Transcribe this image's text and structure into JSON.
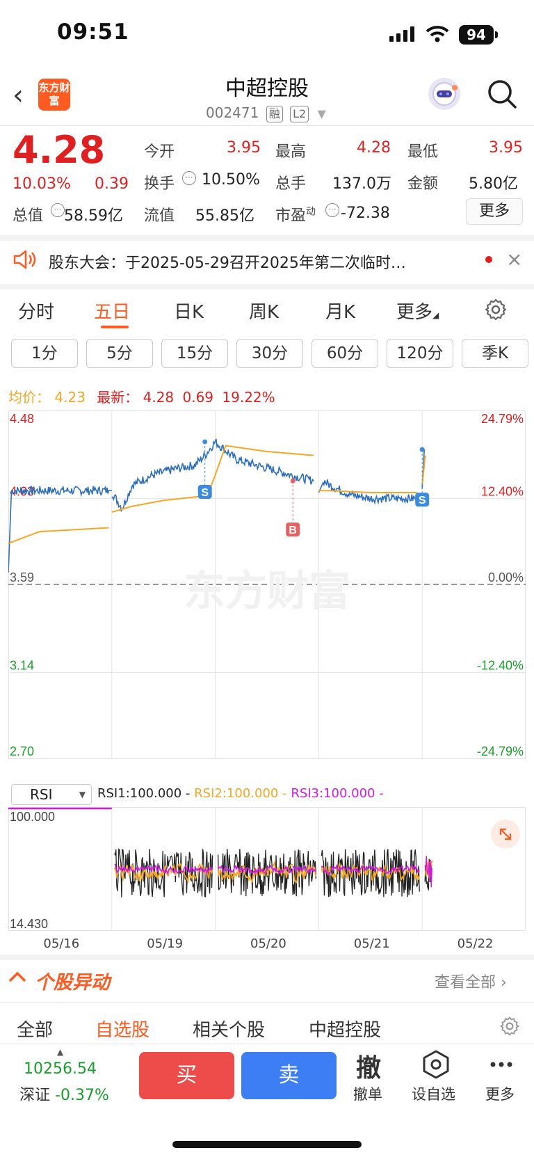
{
  "status": {
    "time": "09:51",
    "battery": "94"
  },
  "header": {
    "title": "中超控股",
    "code": "002471",
    "tag_margin": "融",
    "tag_level": "L2",
    "logo_text": "东方财富"
  },
  "quote": {
    "price": "4.28",
    "pct": "10.03%",
    "change": "0.39",
    "open_label": "今开",
    "open": "3.95",
    "high_label": "最高",
    "high": "4.28",
    "low_label": "最低",
    "low": "3.95",
    "turnover_label": "换手",
    "turnover": "10.50%",
    "volume_label": "总手",
    "volume": "137.0万",
    "amount_label": "金额",
    "amount": "5.80亿",
    "mktcap_label": "总值",
    "mktcap": "58.59亿",
    "float_label": "流值",
    "float": "55.85亿",
    "pe_label": "市盈",
    "pe_sup": "动",
    "pe": "-72.38",
    "more": "更多"
  },
  "notice": {
    "text": "股东大会：于2025-05-29召开2025年第二次临时…"
  },
  "tabs": [
    "分时",
    "五日",
    "日K",
    "周K",
    "月K",
    "更多",
    "settings"
  ],
  "periods": [
    "1分",
    "5分",
    "15分",
    "30分",
    "60分",
    "120分",
    "季K"
  ],
  "legend": {
    "avg_label": "均价：",
    "avg": "4.23",
    "last_label": "最新：",
    "last": "4.28",
    "chg": "0.69",
    "pct": "19.22%"
  },
  "watermark": "东方财富",
  "chart_data": {
    "type": "line",
    "ylim": [
      2.7,
      4.48
    ],
    "y_ticks_left": [
      "4.48",
      "4.03",
      "3.59",
      "3.14",
      "2.70"
    ],
    "y_ticks_right": [
      "24.79%",
      "12.40%",
      "0.00%",
      "-12.40%",
      "-24.79%"
    ],
    "x_labels": [
      "05/16",
      "05/19",
      "05/20",
      "05/21",
      "05/22"
    ],
    "series": [
      {
        "name": "价格",
        "color": "#2a6ebd",
        "segments": [
          [
            [
              0,
              3.65
            ],
            [
              0.03,
              4.07
            ],
            [
              0.97,
              4.07
            ],
            [
              1.0,
              4.07
            ]
          ],
          [
            [
              1.0,
              4.06
            ],
            [
              1.1,
              3.98
            ],
            [
              1.2,
              4.1
            ],
            [
              1.4,
              4.15
            ],
            [
              1.6,
              4.18
            ],
            [
              1.8,
              4.2
            ],
            [
              1.9,
              4.25
            ],
            [
              2.0,
              4.32
            ],
            [
              2.2,
              4.23
            ],
            [
              2.4,
              4.2
            ],
            [
              2.6,
              4.17
            ],
            [
              2.8,
              4.14
            ],
            [
              2.95,
              4.12
            ]
          ],
          [
            [
              3.0,
              4.06
            ],
            [
              3.05,
              4.12
            ],
            [
              3.1,
              4.1
            ],
            [
              3.3,
              4.05
            ],
            [
              3.5,
              4.03
            ],
            [
              3.7,
              4.03
            ],
            [
              3.95,
              4.03
            ]
          ],
          [
            [
              4.0,
              4.08
            ],
            [
              4.02,
              4.28
            ]
          ]
        ]
      },
      {
        "name": "均价",
        "color": "#f5a623",
        "segments": [
          [
            [
              0,
              3.8
            ],
            [
              0.3,
              3.86
            ],
            [
              0.97,
              3.88
            ]
          ],
          [
            [
              1.0,
              3.96
            ],
            [
              1.2,
              3.99
            ],
            [
              1.5,
              4.02
            ],
            [
              1.85,
              4.04
            ],
            [
              1.95,
              4.08
            ],
            [
              2.0,
              4.15
            ],
            [
              2.1,
              4.3
            ],
            [
              2.5,
              4.27
            ],
            [
              2.95,
              4.25
            ]
          ],
          [
            [
              3.0,
              4.07
            ],
            [
              3.1,
              4.07
            ],
            [
              3.5,
              4.06
            ],
            [
              3.95,
              4.06
            ]
          ],
          [
            [
              4.0,
              4.1
            ],
            [
              4.03,
              4.25
            ]
          ]
        ]
      }
    ],
    "markers": [
      {
        "label": "S",
        "day": 1.9,
        "price": 4.32
      },
      {
        "label": "B",
        "day": 2.75,
        "price": 4.12
      },
      {
        "label": "S",
        "day": 4.0,
        "price": 4.28
      }
    ]
  },
  "rsi": {
    "selector": "RSI",
    "rsi1": "RSI1:100.000 -",
    "rsi2": "RSI2:100.000 -",
    "rsi3": "RSI3:100.000 -",
    "top": "100.000",
    "bottom": "14.430"
  },
  "movement": {
    "title": "个股异动",
    "view_all": "查看全部"
  },
  "subtabs": [
    "全部",
    "自选股",
    "相关个股",
    "中超控股"
  ],
  "index": {
    "value": "10256.54",
    "name": "深证",
    "pct": "-0.37%"
  },
  "actions": {
    "buy": "买",
    "sell": "卖",
    "cancel_icon": "撤",
    "cancel": "撤单",
    "add": "设自选",
    "more": "更多"
  }
}
